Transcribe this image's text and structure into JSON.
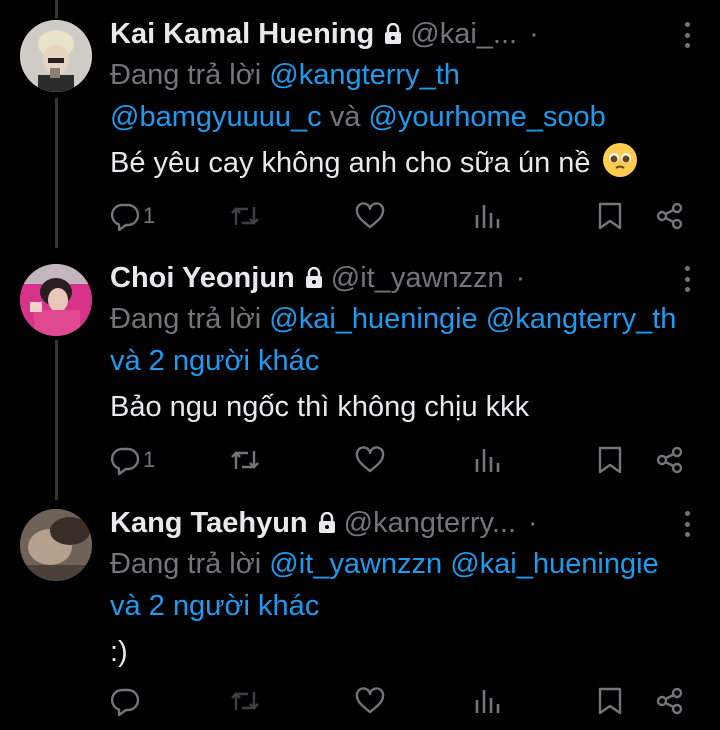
{
  "tweets": [
    {
      "name": "Kai Kamal Huening",
      "handle": "@kai_...",
      "dot": "·",
      "reply_prefix": "Đang trả lời",
      "reply_line1_mention": "@kangterry_th",
      "reply_line2_a": "@bamgyuuuu_c",
      "reply_line2_conj": "và",
      "reply_line2_b": "@yourhome_soob",
      "text": "Bé yêu cay không anh cho sữa ún nề",
      "emoji": "pleading-face",
      "reply_count": "1"
    },
    {
      "name": "Choi Yeonjun",
      "handle": "@it_yawnzzn",
      "dot": "·",
      "reply_prefix": "Đang trả lời",
      "reply_m1": "@kai_hueningie",
      "reply_m2": "@kangterry_th",
      "reply_others": "và 2 người khác",
      "text": "Bảo ngu ngốc thì không chịu kkk",
      "reply_count": "1"
    },
    {
      "name": "Kang Taehyun",
      "handle": "@kangterry...",
      "dot": "·",
      "reply_prefix": "Đang trả lời",
      "reply_m1": "@it_yawnzzn",
      "reply_m2": "@kai_hueningie",
      "reply_others": "và 2 người khác",
      "text": ":)",
      "reply_count": ""
    }
  ],
  "colors": {
    "background": "#000000",
    "text": "#e7e9ea",
    "muted": "#71767b",
    "mention": "#1d9bf0"
  },
  "icons": [
    "lock-icon",
    "more-icon",
    "reply-icon",
    "retweet-icon",
    "like-icon",
    "views-icon",
    "bookmark-icon",
    "share-icon"
  ]
}
